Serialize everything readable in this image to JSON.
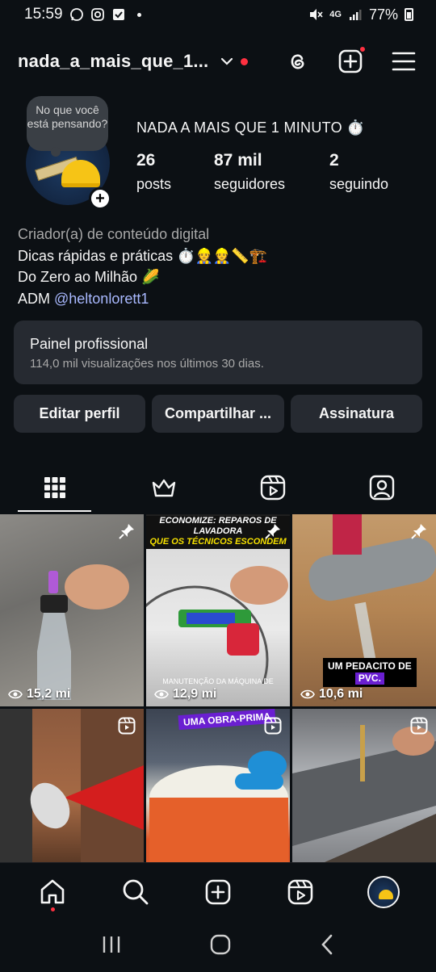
{
  "status_bar": {
    "time": "15:59",
    "network": "4G",
    "battery": "77%"
  },
  "header": {
    "username": "nada_a_mais_que_1...",
    "icons": [
      "chevron-down-icon",
      "threads-icon",
      "create-icon",
      "menu-icon"
    ]
  },
  "profile": {
    "note": "No que você está pensando?",
    "display_name": "NADA A MAIS QUE 1 MINUTO ⏱️",
    "stats": {
      "posts_count": "26",
      "posts_label": "posts",
      "followers_count": "87 mil",
      "followers_label": "seguidores",
      "following_count": "2",
      "following_label": "seguindo"
    },
    "bio": {
      "category": "Criador(a) de conteúdo digital",
      "line1": "Dicas rápidas e práticas ⏱️👷👷📏🏗️",
      "line2": "Do Zero ao Milhão 🌽",
      "adm_prefix": "ADM ",
      "adm_link": "@heltonlorett1"
    }
  },
  "pro_panel": {
    "title": "Painel profissional",
    "subtitle": "114,0 mil visualizações nos últimos 30 dias."
  },
  "buttons": {
    "edit": "Editar perfil",
    "share": "Compartilhar ...",
    "subscription": "Assinatura"
  },
  "tabs": [
    "grid-icon",
    "crown-icon",
    "reels-icon",
    "tagged-icon"
  ],
  "grid": {
    "items": [
      {
        "views": "15,2 mi",
        "pinned": true
      },
      {
        "views": "12,9 mi",
        "pinned": true,
        "caption_top_1": "ECONOMIZE: REPAROS DE LAVADORA",
        "caption_top_2": "QUE OS TÉCNICOS ESCONDEM",
        "caption_bottom": "MANUTENÇÃO DA MÁQUINA DE"
      },
      {
        "views": "10,6 mi",
        "pinned": true,
        "caption": "UM PEDACITO DE",
        "caption2": "PVC."
      },
      {
        "reel": true
      },
      {
        "reel": true,
        "caption": "UMA OBRA-PRIMA"
      },
      {
        "reel": true
      }
    ]
  },
  "bottom_nav": [
    "home-icon",
    "search-icon",
    "create-icon",
    "reels-icon",
    "profile-avatar"
  ],
  "system_nav": [
    "recents-icon",
    "home-circle-icon",
    "back-icon"
  ]
}
